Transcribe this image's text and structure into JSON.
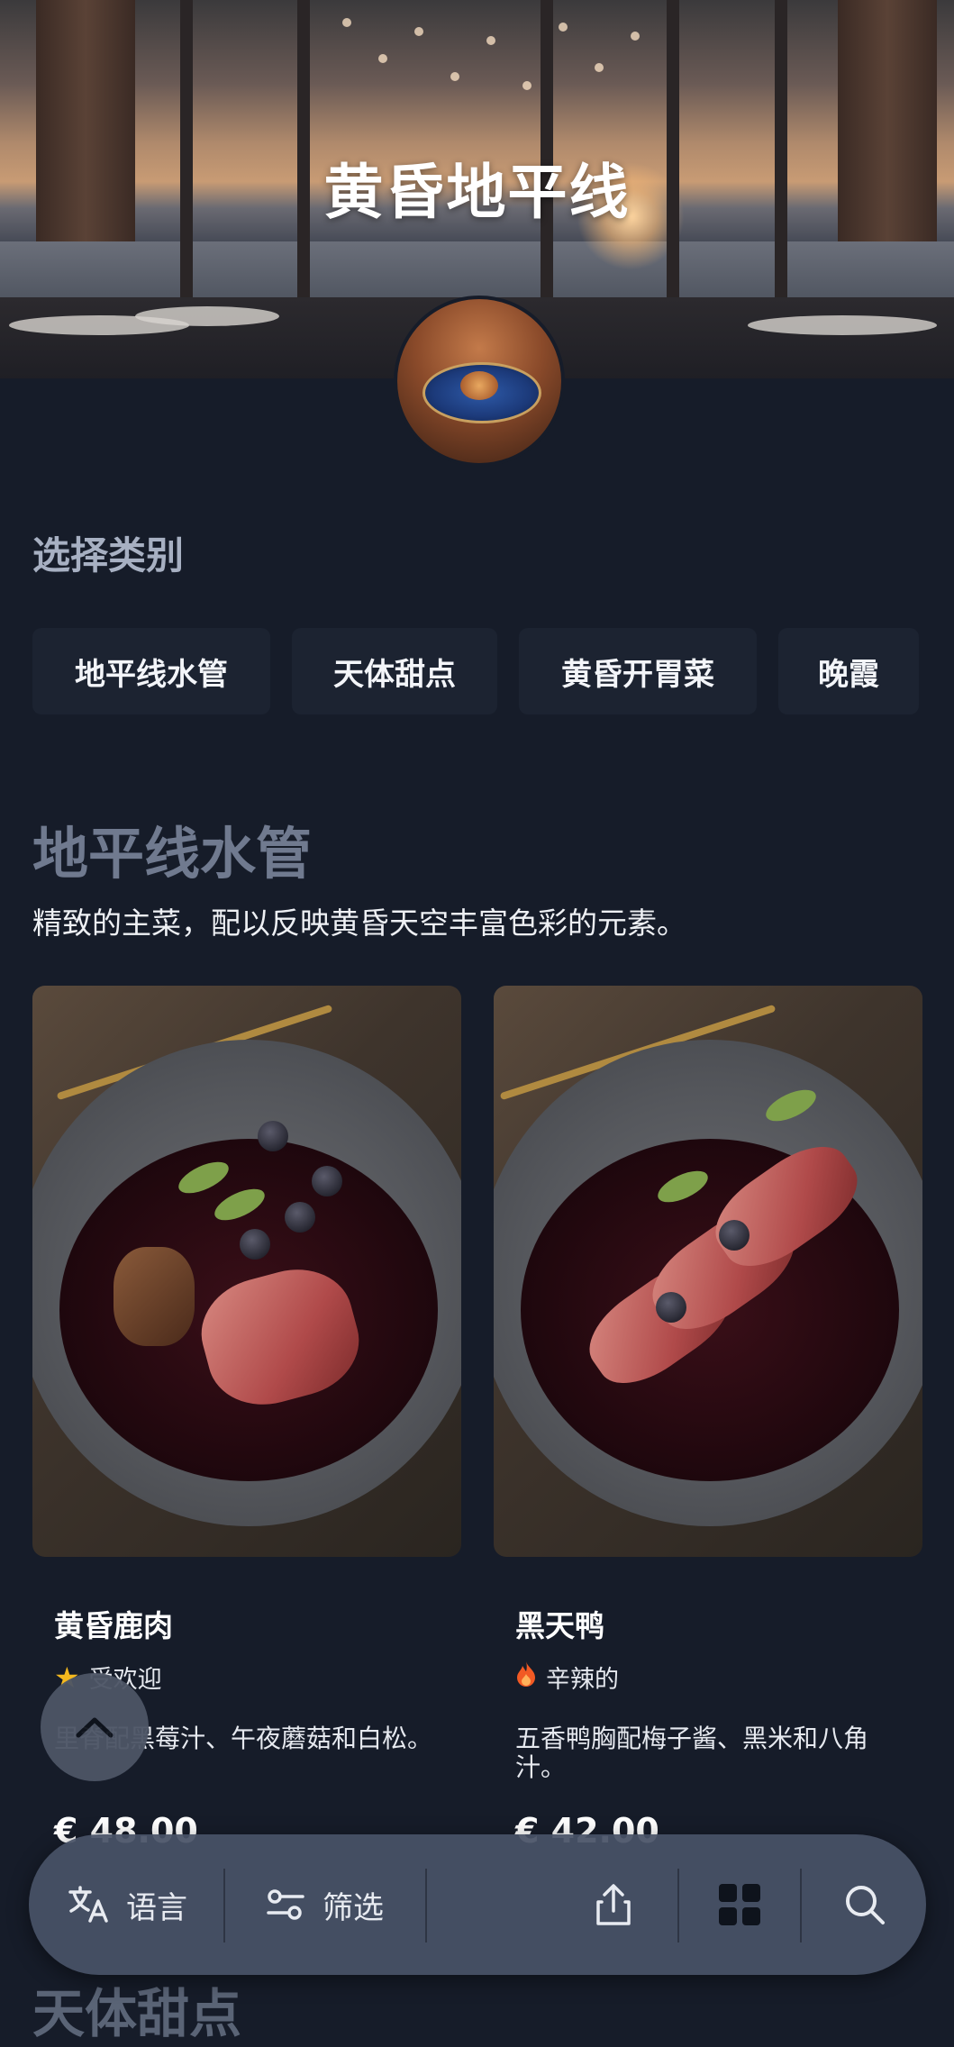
{
  "hero": {
    "title": "黄昏地平线"
  },
  "categories": {
    "heading": "选择类别",
    "items": [
      "地平线水管",
      "天体甜点",
      "黄昏开胃菜",
      "晚霞"
    ]
  },
  "section": {
    "title": "地平线水管",
    "description": "精致的主菜，配以反映黄昏天空丰富色彩的元素。",
    "dishes": [
      {
        "name": "黄昏鹿肉",
        "tag": "受欢迎",
        "tag_icon": "star-icon",
        "description": "里脊配黑莓汁、午夜蘑菇和白松。",
        "price": "€ 48.00"
      },
      {
        "name": "黑天鸭",
        "tag": "辛辣的",
        "tag_icon": "flame-icon",
        "description": "五香鸭胸配梅子酱、黑米和八角汁。",
        "price": "€ 42.00"
      }
    ]
  },
  "next_section": {
    "title": "天体甜点"
  },
  "bottom_bar": {
    "language_label": "语言",
    "filter_label": "筛选"
  },
  "colors": {
    "background": "#161c29",
    "chip_background": "#1c2331",
    "section_title": "#707a8f",
    "star": "#f5b91e",
    "flame": "#f25a24"
  }
}
